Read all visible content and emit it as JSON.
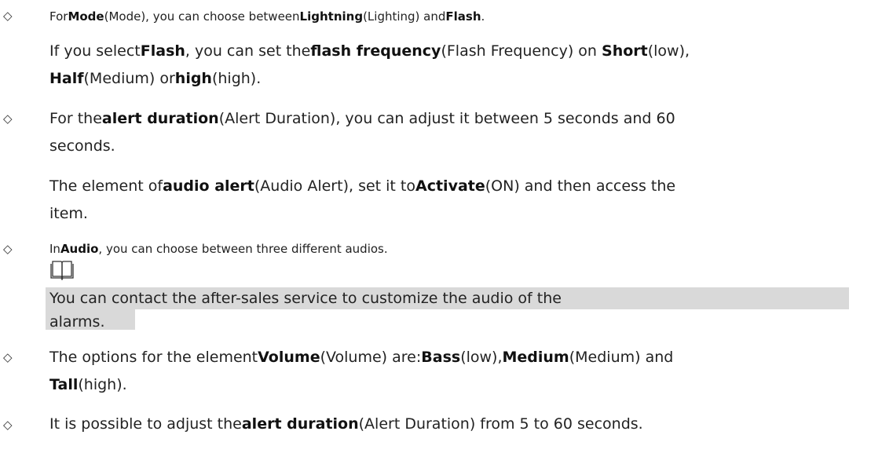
{
  "items": [
    {
      "bullet": "◇",
      "lines": [
        [
          "For",
          "Mode",
          "(Mode), you can choose between",
          "Lightning",
          "(Lighting) and",
          "Flash",
          "."
        ],
        [
          "If you select",
          "Flash",
          ", you can set the",
          "flash frequency",
          "(Flash Frequency) on ",
          "Short",
          "(low),"
        ],
        [
          "Half",
          "(Medium) or",
          "high",
          "(high)."
        ]
      ]
    },
    {
      "bullet": "◇",
      "lines": [
        [
          "For the",
          "alert duration",
          "(Alert Duration), you can adjust it between 5 seconds and 60"
        ],
        [
          "seconds."
        ],
        [
          "The element of",
          "audio alert",
          "(Audio Alert), set it to",
          "Activate",
          "(ON) and then access the"
        ],
        [
          "item."
        ]
      ]
    },
    {
      "bullet": "◇",
      "lines": [
        [
          "In",
          "Audio",
          ", you can choose between three different audios."
        ]
      ],
      "note_icon": "book-note-icon",
      "note_lines": [
        "You can contact the after-sales service to customize the audio of the",
        "alarms."
      ]
    },
    {
      "bullet": "◇",
      "lines": [
        [
          "The options for the element",
          "Volume",
          "(Volume) are:",
          "Bass",
          "(low),",
          "Medium",
          "(Medium) and"
        ],
        [
          "Tall",
          "(high)."
        ]
      ]
    },
    {
      "bullet": "◇",
      "lines": [
        [
          "It is possible to adjust the",
          "alert duration",
          "(Alert Duration) from 5 to 60 seconds."
        ]
      ]
    }
  ],
  "colors": {
    "text": "#222222",
    "note_highlight": "#d9d9d9"
  }
}
